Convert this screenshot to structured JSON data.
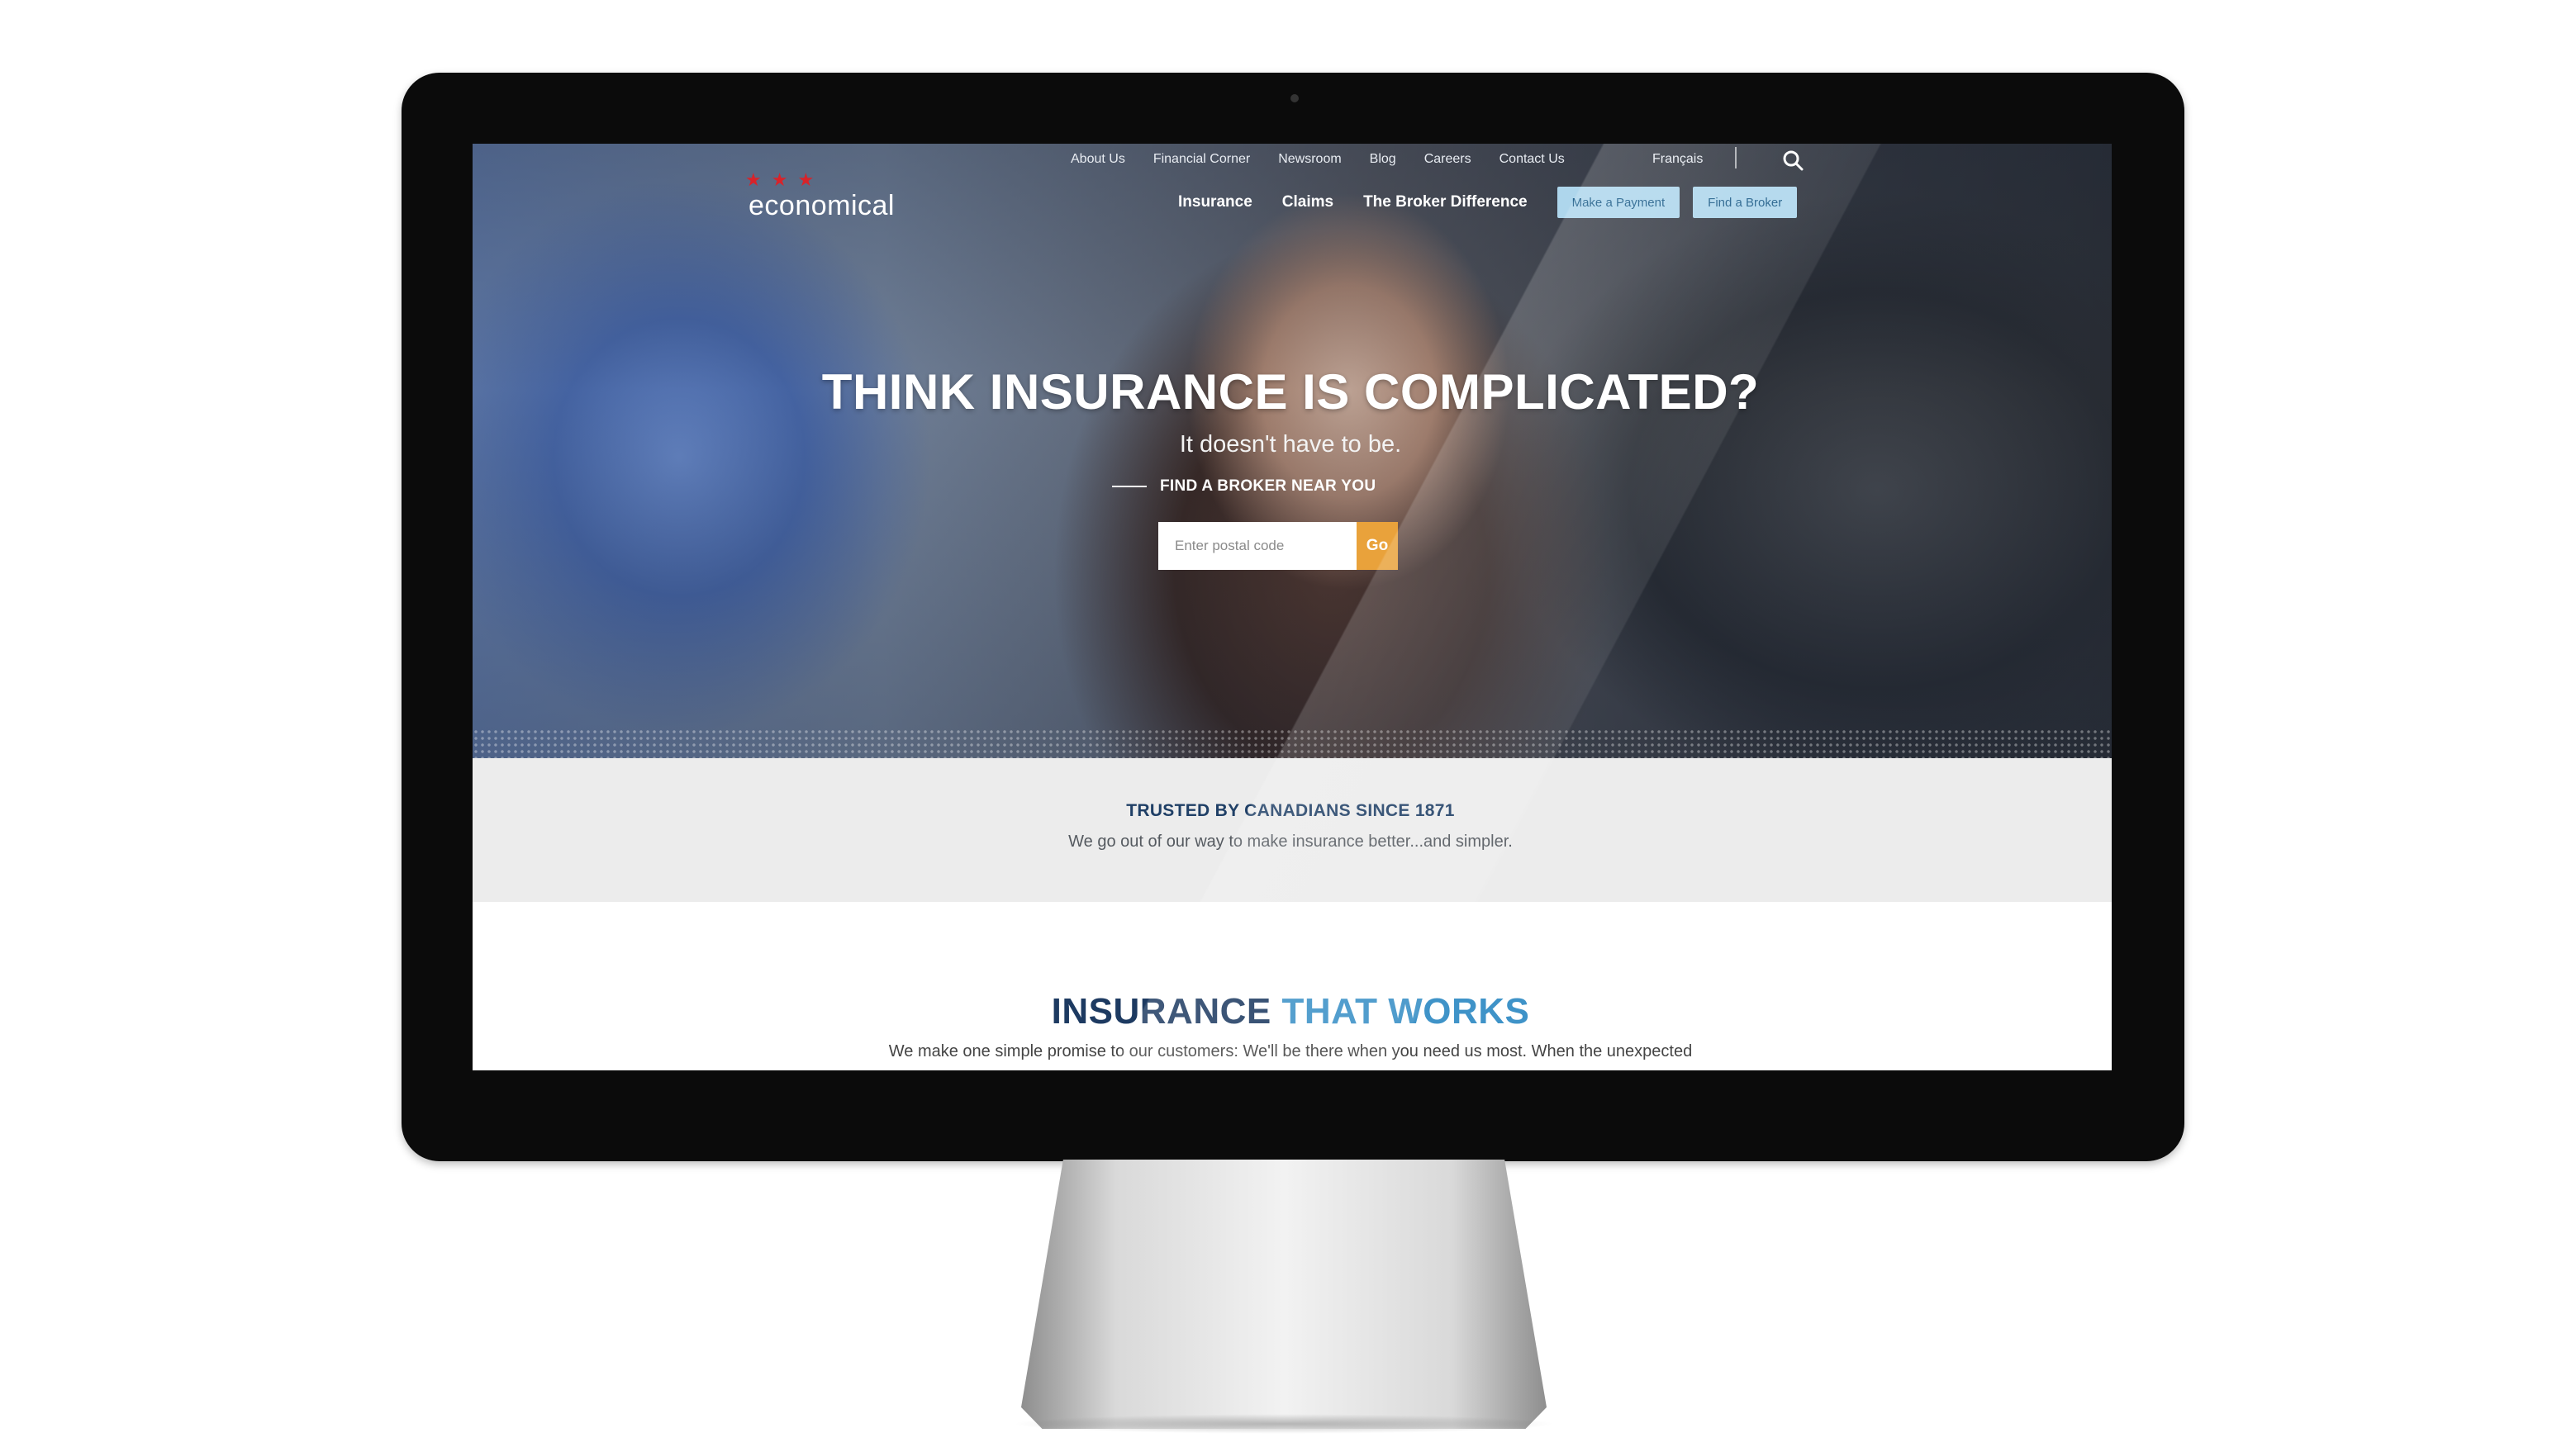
{
  "site": {
    "logo_text": "economical",
    "logo_star": "★"
  },
  "utility_nav": {
    "items": [
      "About Us",
      "Financial Corner",
      "Newsroom",
      "Blog",
      "Careers",
      "Contact Us"
    ],
    "language": "Français",
    "search_icon": "search-icon"
  },
  "main_nav": {
    "items": [
      "Insurance",
      "Claims",
      "The Broker Difference"
    ],
    "make_payment": "Make a Payment",
    "find_broker": "Find a Broker"
  },
  "hero": {
    "title": "THINK INSURANCE IS COMPLICATED?",
    "subtitle": "It doesn't have to be.",
    "broker_label": "FIND A BROKER NEAR YOU",
    "postal_placeholder": "Enter postal code",
    "go_label": "Go"
  },
  "trusted": {
    "title": "TRUSTED BY CANADIANS SINCE 1871",
    "subtitle": "We go out of our way to make insurance better...and simpler."
  },
  "works": {
    "title_dark": "INSURANCE ",
    "title_light": "THAT WORKS",
    "subtitle": "We make one simple promise to our customers: We'll be there when you need us most. When the unexpected"
  },
  "colors": {
    "brand_red": "#d8232a",
    "navy": "#1d3a61",
    "accent_blue": "#3f93c8",
    "go_orange": "#e9a23b",
    "button_blue": "#aed6ec"
  }
}
